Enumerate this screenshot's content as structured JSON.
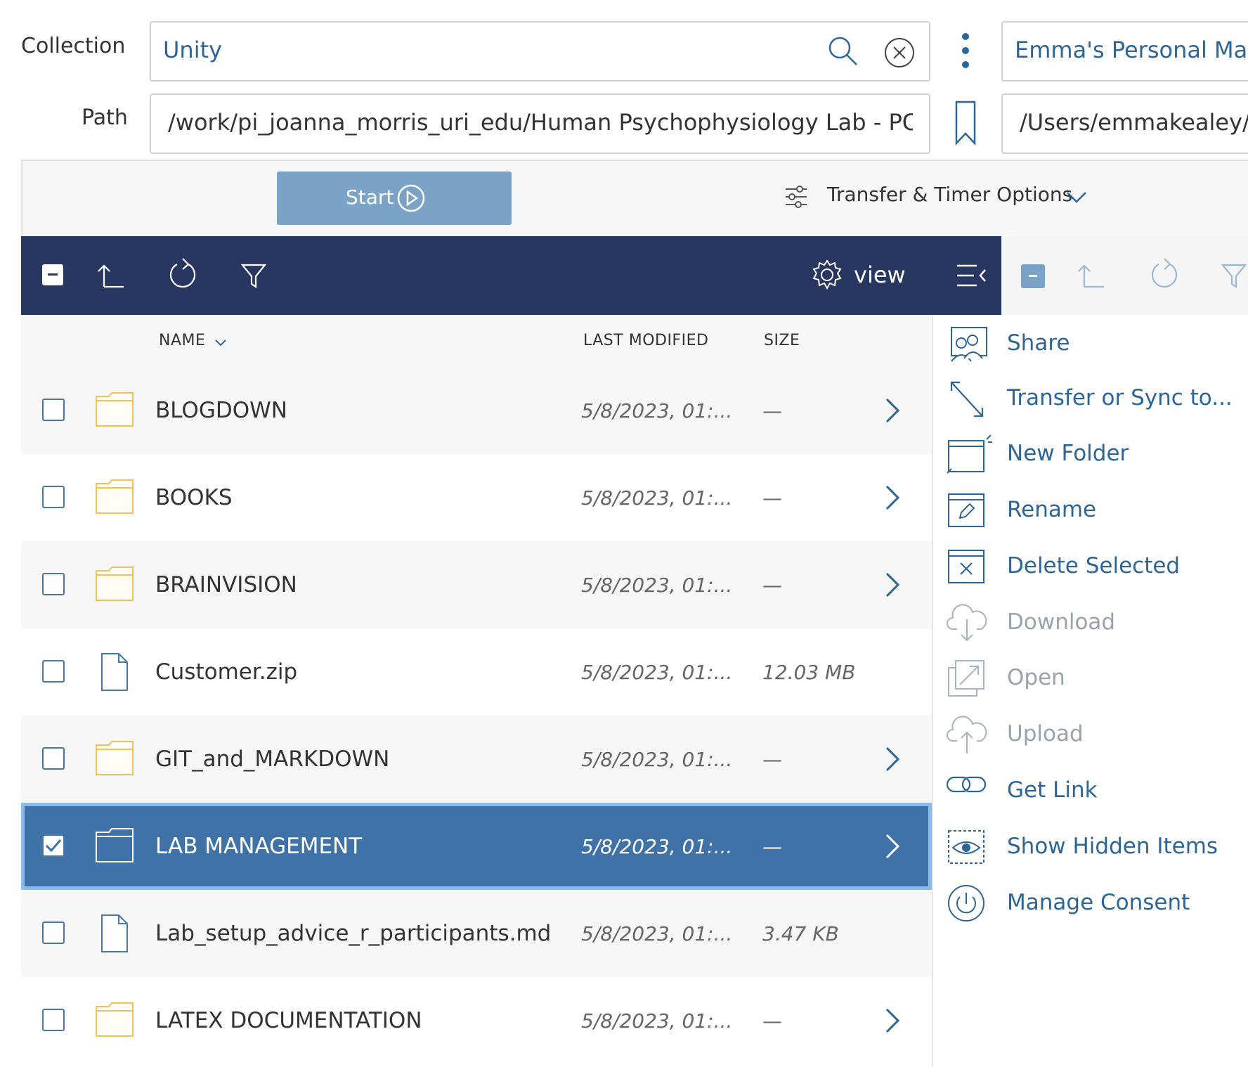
{
  "header": {
    "collection_label": "Collection",
    "collection_value": "Unity",
    "path_label": "Path",
    "path_value": "/work/pi_joanna_morris_uri_edu/Human Psychophysiology Lab - PC_HI",
    "right_collection_value": "Emma's Personal Macb",
    "right_path_value": "/Users/emmakealey/D"
  },
  "controls": {
    "start_label": "Start",
    "options_label": "Transfer & Timer Options"
  },
  "toolbar": {
    "view_label": "view"
  },
  "table": {
    "columns": {
      "name": "NAME",
      "modified": "LAST MODIFIED",
      "size": "SIZE"
    },
    "rows": [
      {
        "name": "BLOGDOWN",
        "modified": "5/8/2023, 01:...",
        "size": "—",
        "type": "folder",
        "selected": false
      },
      {
        "name": "BOOKS",
        "modified": "5/8/2023, 01:...",
        "size": "—",
        "type": "folder",
        "selected": false
      },
      {
        "name": "BRAINVISION",
        "modified": "5/8/2023, 01:...",
        "size": "—",
        "type": "folder",
        "selected": false
      },
      {
        "name": "Customer.zip",
        "modified": "5/8/2023, 01:...",
        "size": "12.03 MB",
        "type": "file",
        "selected": false
      },
      {
        "name": "GIT_and_MARKDOWN",
        "modified": "5/8/2023, 01:...",
        "size": "—",
        "type": "folder",
        "selected": false
      },
      {
        "name": "LAB MANAGEMENT",
        "modified": "5/8/2023, 01:...",
        "size": "—",
        "type": "folder",
        "selected": true
      },
      {
        "name": "Lab_setup_advice_r_participants.md",
        "modified": "5/8/2023, 01:...",
        "size": "3.47 KB",
        "type": "file",
        "selected": false
      },
      {
        "name": "LATEX DOCUMENTATION",
        "modified": "5/8/2023, 01:...",
        "size": "—",
        "type": "folder",
        "selected": false
      }
    ]
  },
  "menu": {
    "items": [
      {
        "label": "Share",
        "icon": "share-icon",
        "enabled": true
      },
      {
        "label": "Transfer or Sync to...",
        "icon": "transfer-icon",
        "enabled": true
      },
      {
        "label": "New Folder",
        "icon": "new-folder-icon",
        "enabled": true
      },
      {
        "label": "Rename",
        "icon": "rename-icon",
        "enabled": true
      },
      {
        "label": "Delete Selected",
        "icon": "delete-icon",
        "enabled": true
      },
      {
        "label": "Download",
        "icon": "download-icon",
        "enabled": false
      },
      {
        "label": "Open",
        "icon": "open-icon",
        "enabled": false
      },
      {
        "label": "Upload",
        "icon": "upload-icon",
        "enabled": false
      },
      {
        "label": "Get Link",
        "icon": "link-icon",
        "enabled": true
      },
      {
        "label": "Show Hidden Items",
        "icon": "eye-icon",
        "enabled": true
      },
      {
        "label": "Manage Consent",
        "icon": "power-icon",
        "enabled": true
      }
    ]
  },
  "colors": {
    "navy": "#283761",
    "accent_blue": "#2c6596",
    "selected_row": "#3f72a6",
    "start_button": "#7ba3c7",
    "folder_yellow": "#f2c14e"
  }
}
